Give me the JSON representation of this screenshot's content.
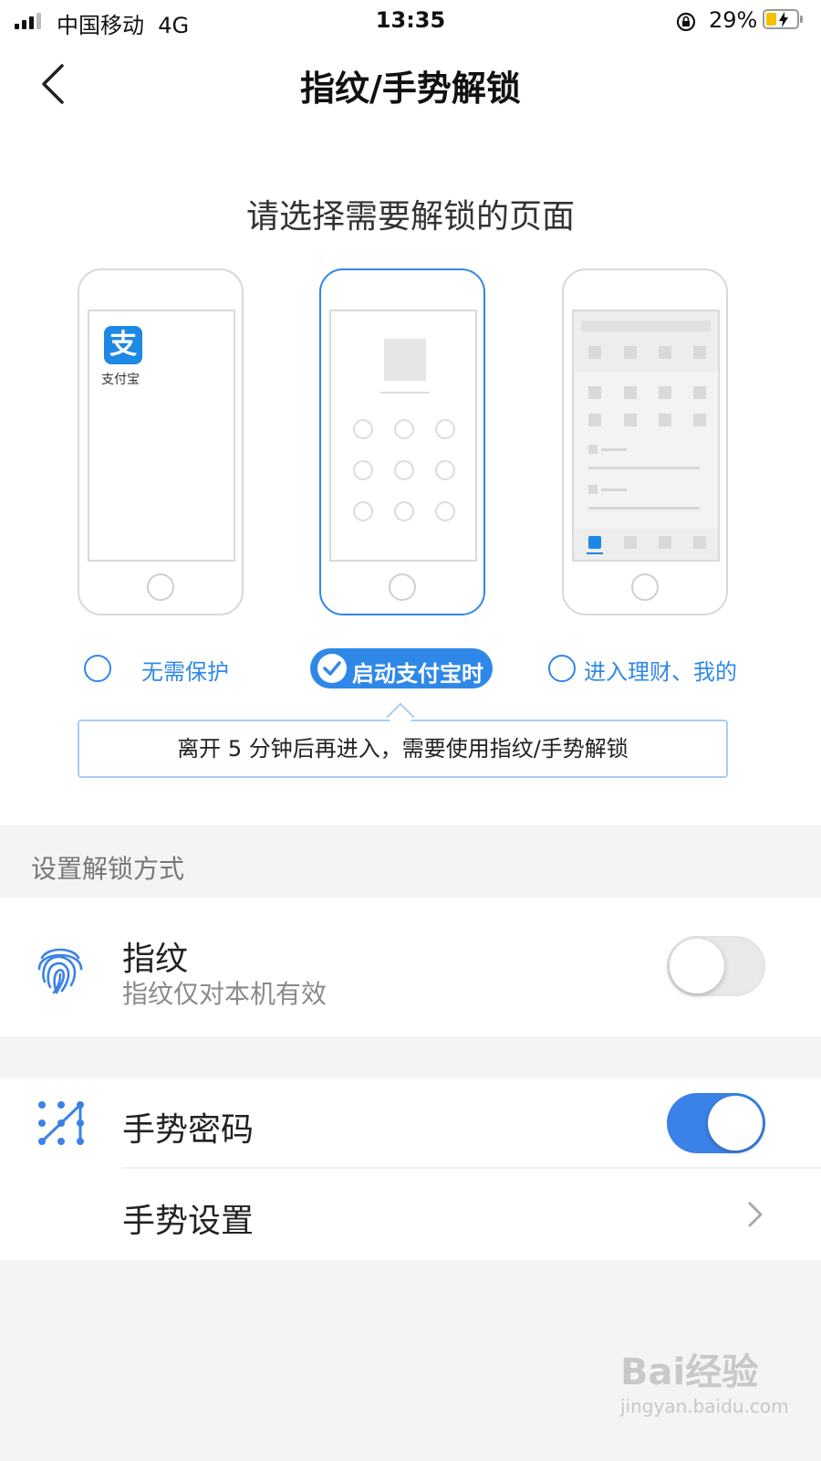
{
  "status_bar": {
    "carrier": "中国移动",
    "network": "4G",
    "time": "13:35",
    "battery": "29%"
  },
  "header": {
    "title": "指纹/手势解锁"
  },
  "selection": {
    "prompt": "请选择需要解锁的页面",
    "app_label": "支付宝",
    "app_glyph": "支",
    "options": [
      {
        "label": "无需保护",
        "selected": false
      },
      {
        "label": "启动支付宝时",
        "selected": true
      },
      {
        "label": "进入理财、我的",
        "selected": false
      }
    ],
    "tip": "离开 5 分钟后再进入，需要使用指纹/手势解锁"
  },
  "settings": {
    "section_title": "设置解锁方式",
    "fingerprint": {
      "title": "指纹",
      "subtitle": "指纹仅对本机有效",
      "enabled": false,
      "icon": "fingerprint-icon"
    },
    "gesture": {
      "title": "手势密码",
      "enabled": true,
      "icon": "gesture-pattern-icon"
    },
    "gesture_settings": {
      "title": "手势设置"
    }
  },
  "watermark": {
    "brand": "Bai经验",
    "url": "jingyan.baidu.com"
  },
  "colors": {
    "accent": "#2f88e8",
    "toggle_on": "#3b82e8",
    "background": "#f4f4f4"
  }
}
